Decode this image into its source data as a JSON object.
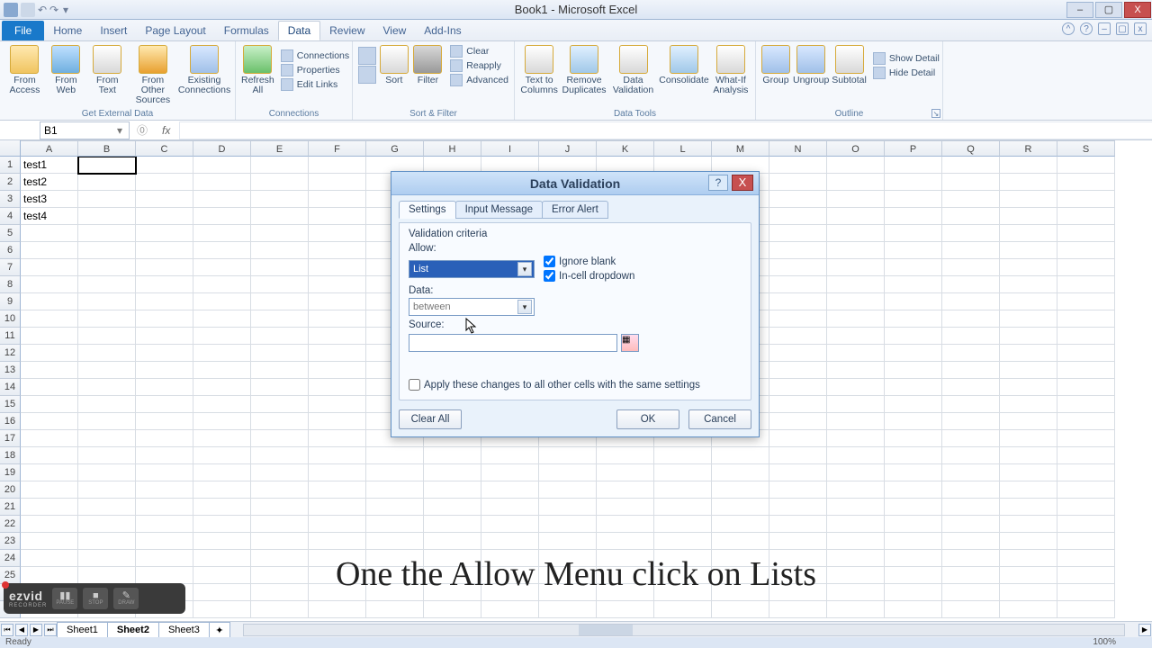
{
  "window": {
    "title": "Book1 - Microsoft Excel",
    "qat": [
      "excel-icon",
      "save-icon",
      "undo-icon",
      "redo-icon",
      "customize-icon"
    ],
    "min": "–",
    "max": "▢",
    "close": "X"
  },
  "tabs": {
    "file": "File",
    "items": [
      "Home",
      "Insert",
      "Page Layout",
      "Formulas",
      "Data",
      "Review",
      "View",
      "Add-Ins"
    ],
    "active": "Data"
  },
  "ribbon": {
    "get_external": {
      "label": "Get External Data",
      "from_access": "From\nAccess",
      "from_web": "From\nWeb",
      "from_text": "From\nText",
      "from_other": "From Other\nSources",
      "existing": "Existing\nConnections"
    },
    "connections": {
      "label": "Connections",
      "refresh": "Refresh\nAll",
      "connections": "Connections",
      "properties": "Properties",
      "edit_links": "Edit Links"
    },
    "sort_filter": {
      "label": "Sort & Filter",
      "sort": "Sort",
      "filter": "Filter",
      "clear": "Clear",
      "reapply": "Reapply",
      "advanced": "Advanced"
    },
    "data_tools": {
      "label": "Data Tools",
      "text_to_cols": "Text to\nColumns",
      "remove_dup": "Remove\nDuplicates",
      "data_val": "Data\nValidation",
      "consolidate": "Consolidate",
      "whatif": "What-If\nAnalysis"
    },
    "outline": {
      "label": "Outline",
      "group": "Group",
      "ungroup": "Ungroup",
      "subtotal": "Subtotal",
      "show_detail": "Show Detail",
      "hide_detail": "Hide Detail"
    }
  },
  "namebox": "B1",
  "columns": [
    "A",
    "B",
    "C",
    "D",
    "E",
    "F",
    "G",
    "H",
    "I",
    "J",
    "K",
    "L",
    "M",
    "N",
    "O",
    "P",
    "Q",
    "R",
    "S"
  ],
  "data_cells": {
    "A1": "test1",
    "A2": "test2",
    "A3": "test3",
    "A4": "test4"
  },
  "selected_cell": "B1",
  "sheets": {
    "items": [
      "Sheet1",
      "Sheet2",
      "Sheet3"
    ],
    "active": "Sheet2"
  },
  "status": "Ready",
  "dialog": {
    "title": "Data Validation",
    "tabs": {
      "settings": "Settings",
      "input": "Input Message",
      "error": "Error Alert"
    },
    "frame_title": "Validation criteria",
    "allow_label": "Allow:",
    "allow_value": "List",
    "ignore_blank": "Ignore blank",
    "incell_dd": "In-cell dropdown",
    "data_label": "Data:",
    "data_value": "between",
    "source_label": "Source:",
    "apply_all": "Apply these changes to all other cells with the same settings",
    "clear_all": "Clear All",
    "ok": "OK",
    "cancel": "Cancel"
  },
  "caption": "One the Allow Menu click on Lists",
  "ezvid": {
    "logo": "ezvid",
    "sub": "RECORDER",
    "pause": "PAUSE",
    "stop": "STOP",
    "draw": "DRAW"
  },
  "zoom": "100%"
}
